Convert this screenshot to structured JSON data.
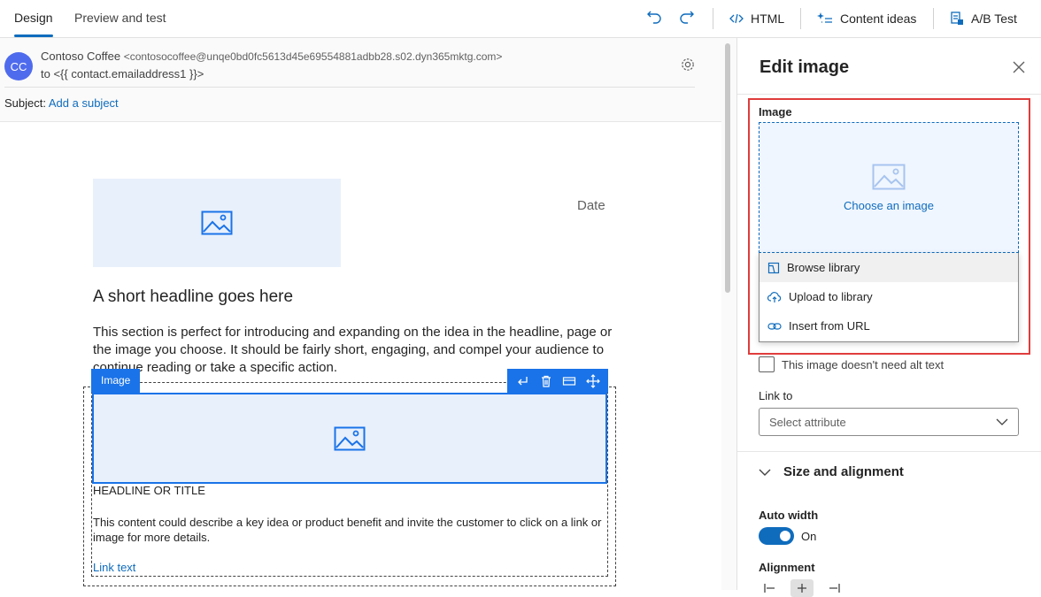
{
  "tabs": [
    {
      "label": "Design",
      "active": true
    },
    {
      "label": "Preview and test",
      "active": false
    }
  ],
  "toolbar": {
    "html_label": "HTML",
    "content_ideas_label": "Content ideas",
    "ab_test_label": "A/B Test"
  },
  "email_header": {
    "avatar_initials": "CC",
    "from_name": "Contoso Coffee",
    "from_address": "<contosocoffee@unqe0bd0fc5613d45e69554881adbb28.s02.dyn365mktg.com>",
    "to_line": "to <{{ contact.emailaddress1 }}>",
    "subject_label": "Subject:",
    "subject_link": "Add a subject"
  },
  "canvas": {
    "date_text": "Date",
    "headline": "A short headline goes here",
    "paragraph": "This section is perfect for introducing and expanding on the idea in the headline, page or the image you choose. It should be fairly short, engaging, and compel your audience to continue reading or take a specific action.",
    "selected_block_label": "Image",
    "block_title": "HEADLINE OR TITLE",
    "block_body": "This content could describe a key idea or product benefit and invite the customer to click on a link or image for more details.",
    "block_link": "Link text"
  },
  "panel": {
    "title": "Edit image",
    "image_label": "Image",
    "choose_image": "Choose an image",
    "menu_items": [
      {
        "label": "Browse library",
        "icon": "library-icon"
      },
      {
        "label": "Upload to library",
        "icon": "cloud-upload-icon"
      },
      {
        "label": "Insert from URL",
        "icon": "link-icon"
      }
    ],
    "alt_text_checkbox": "This image doesn't need alt text",
    "link_to_label": "Link to",
    "link_to_placeholder": "Select attribute",
    "size_section": "Size and alignment",
    "auto_width_label": "Auto width",
    "auto_width_state": "On",
    "alignment_label": "Alignment"
  },
  "colors": {
    "accent": "#0f6cbd",
    "selection_blue": "#1a73e8",
    "highlight_red": "#e03c3c",
    "avatar": "#4f6bed"
  }
}
